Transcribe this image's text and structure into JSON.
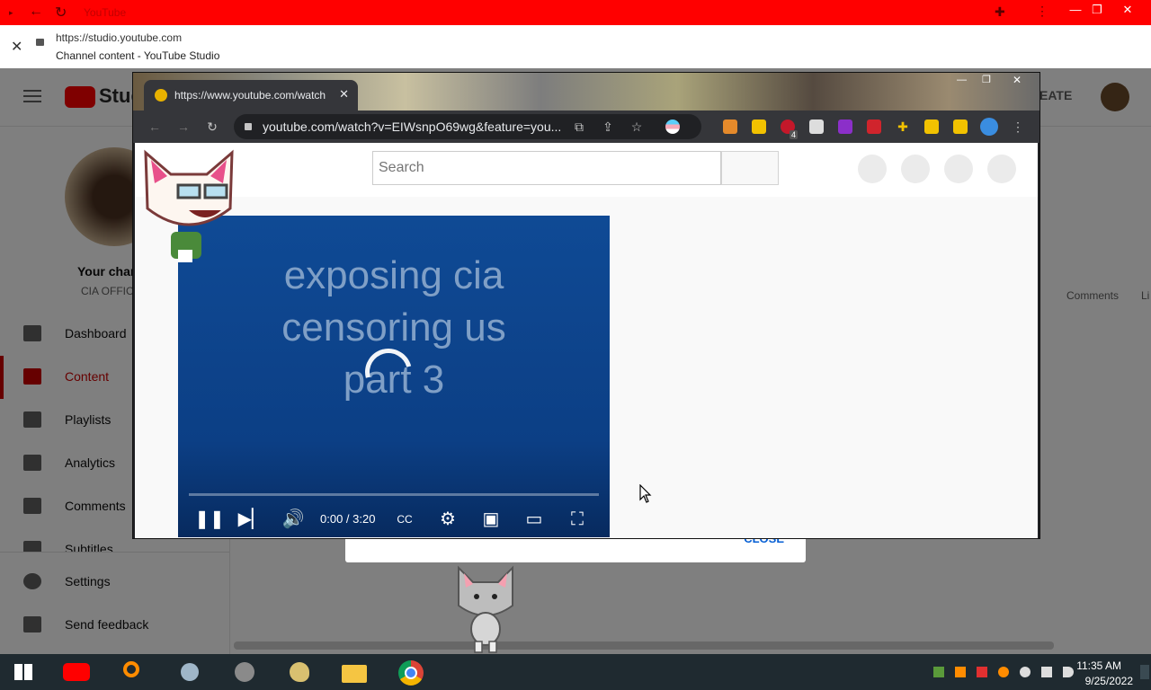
{
  "outer_window": {
    "title": "YouTube",
    "url": "https://studio.youtube.com",
    "page_title": "Channel content - YouTube Studio"
  },
  "studio": {
    "logo_text": "Stud",
    "create_label": "EATE",
    "channel_label": "Your char",
    "channel_sub": "CIA OFFIC",
    "nav": {
      "dashboard": "Dashboard",
      "content": "Content",
      "playlists": "Playlists",
      "analytics": "Analytics",
      "comments": "Comments",
      "subtitles": "Subtitles",
      "settings": "Settings",
      "feedback": "Send feedback"
    },
    "tabs_right": [
      "Comments",
      "Li"
    ],
    "modal_close": "CLOSE"
  },
  "browser": {
    "tab_title": "https://www.youtube.com/watch",
    "omnibox_text": "youtube.com/watch?v=EIWsnpO69wg&feature=you...",
    "ublock_badge": "4"
  },
  "youtube": {
    "search_placeholder": "Search"
  },
  "player": {
    "video_text_line1": "exposing cia",
    "video_text_line2": "censoring us",
    "video_text_line3": "part 3",
    "time": "0:00 / 3:20",
    "progress": 0
  },
  "taskbar": {
    "time": "11:35 AM",
    "date": "9/25/2022"
  },
  "colors": {
    "youtube_red": "#ff0000",
    "studio_active": "#cc0000",
    "player_blue": "#0f4a95",
    "taskbar": "#1f2a30"
  }
}
